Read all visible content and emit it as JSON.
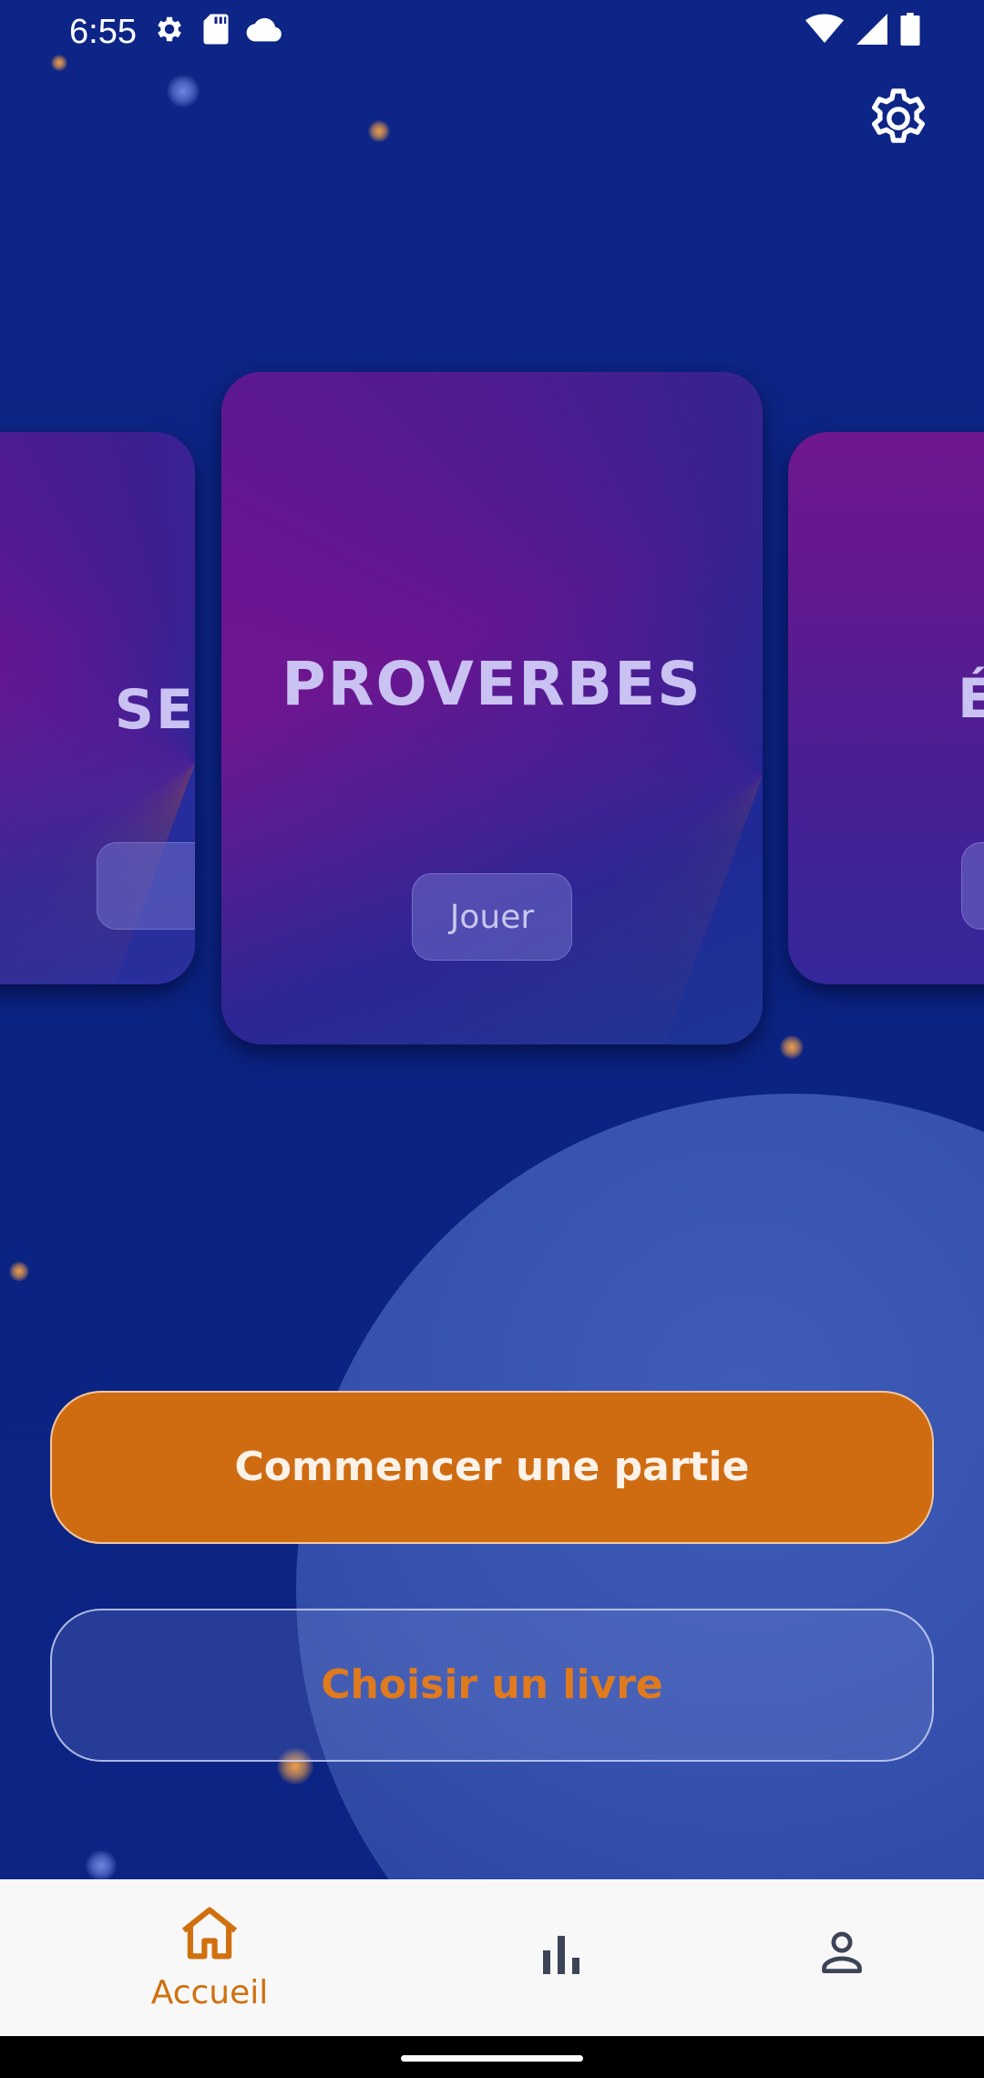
{
  "status_bar": {
    "time": "6:55",
    "left_icons": [
      "gear-icon",
      "sd-card-icon",
      "cloud-icon"
    ],
    "right_icons": [
      "wifi-icon",
      "signal-icon",
      "battery-icon"
    ]
  },
  "header": {
    "settings_icon": "gear-icon"
  },
  "carousel": {
    "cards": [
      {
        "title": "SE",
        "position": "left-partial"
      },
      {
        "title": "PROVERBES",
        "play_label": "Jouer",
        "position": "center"
      },
      {
        "title": "É",
        "position": "right-partial"
      }
    ]
  },
  "actions": {
    "start_label": "Commencer une partie",
    "choose_book_label": "Choisir un livre"
  },
  "bottom_nav": {
    "items": [
      {
        "label": "Accueil",
        "icon": "home-icon",
        "active": true
      },
      {
        "label": "",
        "icon": "bar-chart-icon",
        "active": false
      },
      {
        "label": "",
        "icon": "person-icon",
        "active": false
      }
    ]
  },
  "colors": {
    "background": "#0c2480",
    "accent_orange": "#cf6c12",
    "card_title": "#c9c2f2",
    "nav_active": "#d0700f",
    "nav_inactive": "#3d4458"
  }
}
